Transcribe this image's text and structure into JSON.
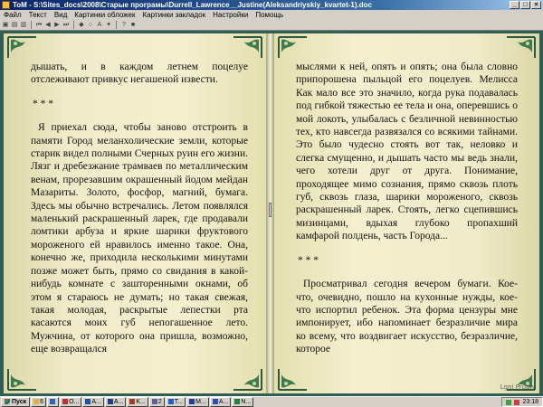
{
  "window": {
    "title": "ToM - S:\\Sites_docs\\2008\\Старые програмы\\Durrell_Lawrence__Justine(Aleksandriyskiy_kvartet-1).doc"
  },
  "menu": [
    "Файл",
    "Текст",
    "Вид",
    "Картинки обложек",
    "Картинки закладок",
    "Настройки",
    "Помощь"
  ],
  "book": {
    "left_page": {
      "paragraphs": [
        "дышать, и в каждом летнем поцелуе отслеживают привкус негашеной извести."
      ],
      "separator": "* * *",
      "paragraphs_after": [
        "Я приехал сюда, чтобы заново отстроить в памяти Город меланхолические земли, которые старик видел полными Счерных руин его жизни. Лязг и дребезжание трамваев по металлическим венам, прорезавшим окрашенный йодом мейдан Мазариты. Золото, фосфор, магний, бумага. Здесь мы обычно встречались. Летом появлялся маленький раскрашенный ларек, где продавали ломтики арбуза и яркие шарики фруктового мороженого ей нравилось именно такое. Она, конечно же, приходила несколькими минутами позже может быть, прямо со свидания в какой-нибудь комнате с зашторенными окнами, об этом я стараюсь не думать; но такая свежая, такая молодая, раскрытые лепестки рта касаются моих губ непогашенное лето. Мужчина, от которого она пришла, возможно, еще возвращался"
      ]
    },
    "right_page": {
      "paragraphs": [
        "мыслями к ней, опять и опять; она была словно припорошена пыльцой его поцелуев. Мелисса Как мало все это значило, когда рука подавалась под гибкой тяжестью ее тела и она, оперевшись о мой локоть, улыбалась с безличной невинностью тех, кто навсегда развязался со всякими тайнами. Это было чудесно стоять вот так, неловко и слегка смущенно, и дышать часто мы ведь знали, чего хотели друг от друга. Понимание, проходящее мимо сознания, прямо сквозь плоть губ, сквозь глаза, шарики мороженого, сквозь раскрашенный ларек. Стоять, легко сцепившись мизинцами, вдыхая глубоко пропахший камфарой полдень, часть Города..."
      ],
      "separator": "* * *",
      "paragraphs_after": [
        "Просматривал сегодня вечером бумаги. Кое-что, очевидно, пошло на кухонные нужды, кое-что испортил ребенок. Эта форма цензуры мне импонирует, ибо напоминает безразличие мира ко всему, что воздвигает искусство, безразличие, которое"
      ],
      "corner_label": "Lgnj Prubn"
    }
  },
  "taskbar": {
    "start_label": "Пуск",
    "tasks": [
      {
        "label": "6",
        "icon": "folder-icon",
        "color": "#e0b040"
      },
      {
        "label": "",
        "icon": "app-icon",
        "color": "#3060c0"
      },
      {
        "label": "O...",
        "icon": "app-icon",
        "color": "#c03030"
      },
      {
        "label": "A...",
        "icon": "app-icon",
        "color": "#2050a0"
      },
      {
        "label": "A...",
        "icon": "app-icon",
        "color": "#204080"
      },
      {
        "label": "K...",
        "icon": "app-icon",
        "color": "#a04020"
      },
      {
        "label": "2",
        "icon": "app-icon",
        "color": "#6060a0"
      },
      {
        "label": "T...",
        "icon": "app-icon",
        "color": "#2060c0"
      },
      {
        "label": "M...",
        "icon": "word-icon",
        "color": "#2040a0"
      },
      {
        "label": "A...",
        "icon": "app-icon",
        "color": "#3050b0"
      },
      {
        "label": "N...",
        "icon": "app-icon",
        "color": "#208040"
      }
    ],
    "clock": "23:18"
  },
  "colors": {
    "background": "#2f5f53",
    "page": "#f3efcf",
    "title_bar": "#0a246a"
  }
}
